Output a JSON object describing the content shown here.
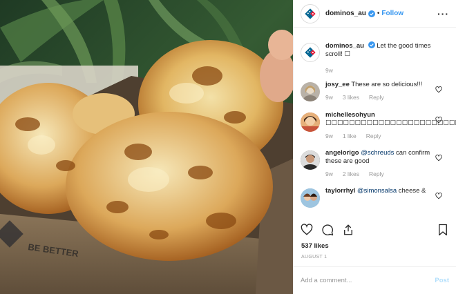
{
  "header": {
    "username": "dominos_au",
    "separator": "•",
    "follow_label": "Follow",
    "more_label": "···"
  },
  "caption": {
    "username": "dominos_au",
    "text": "Let the good times scroll! ",
    "emoji": "☐",
    "time": "9w"
  },
  "comments": [
    {
      "username": "josy_ee",
      "text": "These are so delicious!!!",
      "time": "9w",
      "likes": "3 likes",
      "reply": "Reply",
      "avatar_color": "#b9b2a8"
    },
    {
      "username": "michellesohyun",
      "text": "☐☐☐☐☐☐☐☐☐☐☐☐☐☐☐☐☐☐☐☐☐☐☐",
      "time": "9w",
      "likes": "1 like",
      "reply": "Reply",
      "avatar_color": "#c8553c"
    },
    {
      "username": "angelorigo",
      "mention": "@schreuds",
      "text": "can confirm these are good",
      "time": "9w",
      "likes": "2 likes",
      "reply": "Reply",
      "avatar_color": "#3a3530"
    },
    {
      "username": "taylorrhyl",
      "mention": "@simonsalsa",
      "text": "cheese &",
      "avatar_color": "#7aa7c9"
    }
  ],
  "stats": {
    "likes": "537 likes",
    "date": "AUGUST 1"
  },
  "add_comment": {
    "placeholder": "Add a comment...",
    "post_label": "Post"
  },
  "image_overlay": {
    "box_text": "BE BETTER"
  },
  "colors": {
    "link_blue": "#3897f0",
    "post_disabled": "#b2dffc",
    "verified": "#3897f0",
    "brand_blue": "#006491",
    "brand_red": "#e31837"
  },
  "icons": [
    "dominos-logo-icon",
    "verified-badge-icon",
    "heart-icon",
    "comment-icon",
    "share-icon",
    "bookmark-icon"
  ]
}
